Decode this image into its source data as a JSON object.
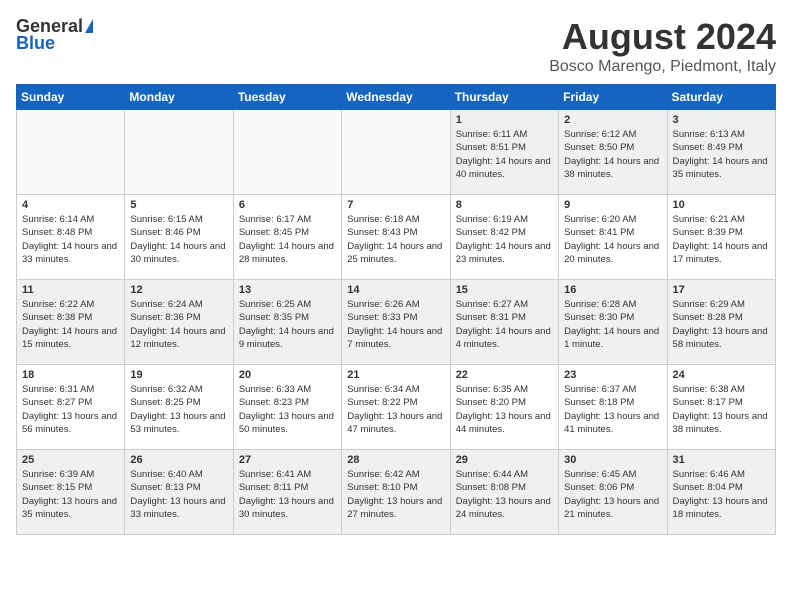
{
  "logo": {
    "general": "General",
    "blue": "Blue"
  },
  "title": "August 2024",
  "subtitle": "Bosco Marengo, Piedmont, Italy",
  "days_of_week": [
    "Sunday",
    "Monday",
    "Tuesday",
    "Wednesday",
    "Thursday",
    "Friday",
    "Saturday"
  ],
  "weeks": [
    [
      {
        "day": "",
        "info": "",
        "empty": true
      },
      {
        "day": "",
        "info": "",
        "empty": true
      },
      {
        "day": "",
        "info": "",
        "empty": true
      },
      {
        "day": "",
        "info": "",
        "empty": true
      },
      {
        "day": "1",
        "info": "Sunrise: 6:11 AM\nSunset: 8:51 PM\nDaylight: 14 hours and 40 minutes."
      },
      {
        "day": "2",
        "info": "Sunrise: 6:12 AM\nSunset: 8:50 PM\nDaylight: 14 hours and 38 minutes."
      },
      {
        "day": "3",
        "info": "Sunrise: 6:13 AM\nSunset: 8:49 PM\nDaylight: 14 hours and 35 minutes."
      }
    ],
    [
      {
        "day": "4",
        "info": "Sunrise: 6:14 AM\nSunset: 8:48 PM\nDaylight: 14 hours and 33 minutes."
      },
      {
        "day": "5",
        "info": "Sunrise: 6:15 AM\nSunset: 8:46 PM\nDaylight: 14 hours and 30 minutes."
      },
      {
        "day": "6",
        "info": "Sunrise: 6:17 AM\nSunset: 8:45 PM\nDaylight: 14 hours and 28 minutes."
      },
      {
        "day": "7",
        "info": "Sunrise: 6:18 AM\nSunset: 8:43 PM\nDaylight: 14 hours and 25 minutes."
      },
      {
        "day": "8",
        "info": "Sunrise: 6:19 AM\nSunset: 8:42 PM\nDaylight: 14 hours and 23 minutes."
      },
      {
        "day": "9",
        "info": "Sunrise: 6:20 AM\nSunset: 8:41 PM\nDaylight: 14 hours and 20 minutes."
      },
      {
        "day": "10",
        "info": "Sunrise: 6:21 AM\nSunset: 8:39 PM\nDaylight: 14 hours and 17 minutes."
      }
    ],
    [
      {
        "day": "11",
        "info": "Sunrise: 6:22 AM\nSunset: 8:38 PM\nDaylight: 14 hours and 15 minutes."
      },
      {
        "day": "12",
        "info": "Sunrise: 6:24 AM\nSunset: 8:36 PM\nDaylight: 14 hours and 12 minutes."
      },
      {
        "day": "13",
        "info": "Sunrise: 6:25 AM\nSunset: 8:35 PM\nDaylight: 14 hours and 9 minutes."
      },
      {
        "day": "14",
        "info": "Sunrise: 6:26 AM\nSunset: 8:33 PM\nDaylight: 14 hours and 7 minutes."
      },
      {
        "day": "15",
        "info": "Sunrise: 6:27 AM\nSunset: 8:31 PM\nDaylight: 14 hours and 4 minutes."
      },
      {
        "day": "16",
        "info": "Sunrise: 6:28 AM\nSunset: 8:30 PM\nDaylight: 14 hours and 1 minute."
      },
      {
        "day": "17",
        "info": "Sunrise: 6:29 AM\nSunset: 8:28 PM\nDaylight: 13 hours and 58 minutes."
      }
    ],
    [
      {
        "day": "18",
        "info": "Sunrise: 6:31 AM\nSunset: 8:27 PM\nDaylight: 13 hours and 56 minutes."
      },
      {
        "day": "19",
        "info": "Sunrise: 6:32 AM\nSunset: 8:25 PM\nDaylight: 13 hours and 53 minutes."
      },
      {
        "day": "20",
        "info": "Sunrise: 6:33 AM\nSunset: 8:23 PM\nDaylight: 13 hours and 50 minutes."
      },
      {
        "day": "21",
        "info": "Sunrise: 6:34 AM\nSunset: 8:22 PM\nDaylight: 13 hours and 47 minutes."
      },
      {
        "day": "22",
        "info": "Sunrise: 6:35 AM\nSunset: 8:20 PM\nDaylight: 13 hours and 44 minutes."
      },
      {
        "day": "23",
        "info": "Sunrise: 6:37 AM\nSunset: 8:18 PM\nDaylight: 13 hours and 41 minutes."
      },
      {
        "day": "24",
        "info": "Sunrise: 6:38 AM\nSunset: 8:17 PM\nDaylight: 13 hours and 38 minutes."
      }
    ],
    [
      {
        "day": "25",
        "info": "Sunrise: 6:39 AM\nSunset: 8:15 PM\nDaylight: 13 hours and 35 minutes."
      },
      {
        "day": "26",
        "info": "Sunrise: 6:40 AM\nSunset: 8:13 PM\nDaylight: 13 hours and 33 minutes."
      },
      {
        "day": "27",
        "info": "Sunrise: 6:41 AM\nSunset: 8:11 PM\nDaylight: 13 hours and 30 minutes."
      },
      {
        "day": "28",
        "info": "Sunrise: 6:42 AM\nSunset: 8:10 PM\nDaylight: 13 hours and 27 minutes."
      },
      {
        "day": "29",
        "info": "Sunrise: 6:44 AM\nSunset: 8:08 PM\nDaylight: 13 hours and 24 minutes."
      },
      {
        "day": "30",
        "info": "Sunrise: 6:45 AM\nSunset: 8:06 PM\nDaylight: 13 hours and 21 minutes."
      },
      {
        "day": "31",
        "info": "Sunrise: 6:46 AM\nSunset: 8:04 PM\nDaylight: 13 hours and 18 minutes."
      }
    ]
  ]
}
